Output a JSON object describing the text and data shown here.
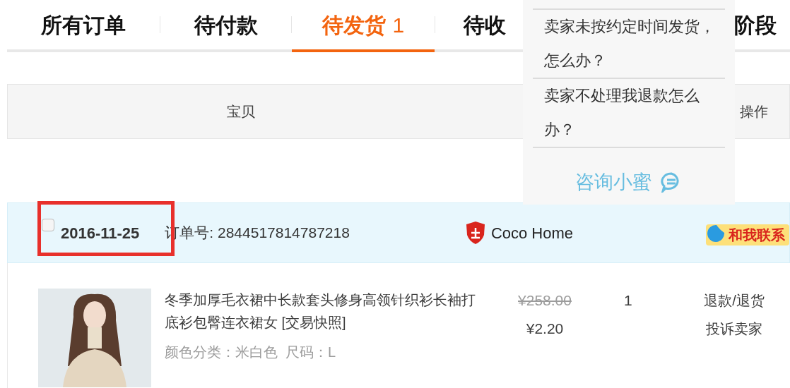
{
  "tabs": [
    {
      "label": "所有订单",
      "selected": false
    },
    {
      "label": "待付款",
      "selected": false
    },
    {
      "label": "待发货",
      "count": "1",
      "selected": true
    },
    {
      "label": "待收",
      "selected": false
    },
    {
      "label": "阶段",
      "selected": false
    }
  ],
  "table": {
    "columns": [
      "宝贝",
      "操作"
    ]
  },
  "help_popup": {
    "questions": [
      "卖家未按约定时间发货，怎么办？",
      "卖家不处理我退款怎么办？"
    ],
    "link": "咨询小蜜"
  },
  "order": {
    "checked": false,
    "date": "2016-11-25",
    "date_highlighted": true,
    "order_number": "订单号: 2844517814787218",
    "shop": "Coco Home",
    "contact": "和我联系",
    "item": {
      "title": "冬季加厚毛衣裙中长款套头修身高领针织衫长袖打底衫包臀连衣裙女 [交易快照]",
      "sku": "颜色分类：米白色  尺码：L",
      "original_price": "¥258.00",
      "price": "¥2.20",
      "quantity": "1",
      "actions": [
        "退款/退货",
        "投诉卖家"
      ]
    }
  }
}
